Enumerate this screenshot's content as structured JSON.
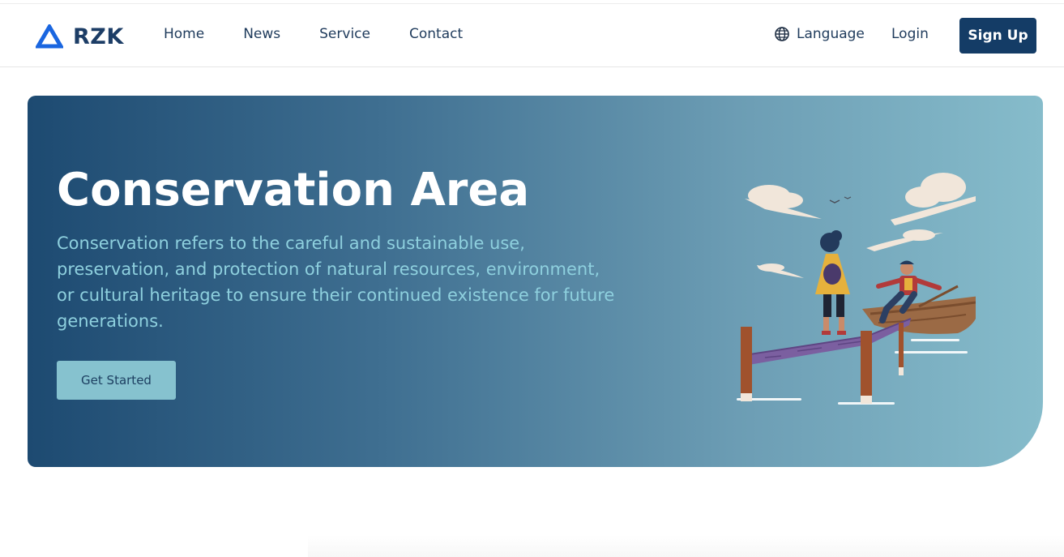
{
  "brand": {
    "name": "RZK",
    "logo_icon": "triangle-logo-icon"
  },
  "nav": {
    "links": [
      {
        "label": "Home"
      },
      {
        "label": "News"
      },
      {
        "label": "Service"
      },
      {
        "label": "Contact"
      }
    ],
    "language_label": "Language",
    "language_icon": "globe-icon",
    "login_label": "Login",
    "signup_label": "Sign Up"
  },
  "hero": {
    "title": "Conservation Area",
    "description": "Conservation refers to the careful and sustainable use, preservation, and protection of natural resources, environment, or cultural heritage to ensure their continued existence for future generations.",
    "cta_label": "Get Started",
    "illustration": "dock-and-rowboat-illustration"
  },
  "colors": {
    "primary": "#143c66",
    "hero_gradient_start": "#1d4a71",
    "hero_gradient_end": "#86bccb",
    "hero_text_accent": "#8ed0de",
    "cta_bg": "#86c2cf"
  }
}
